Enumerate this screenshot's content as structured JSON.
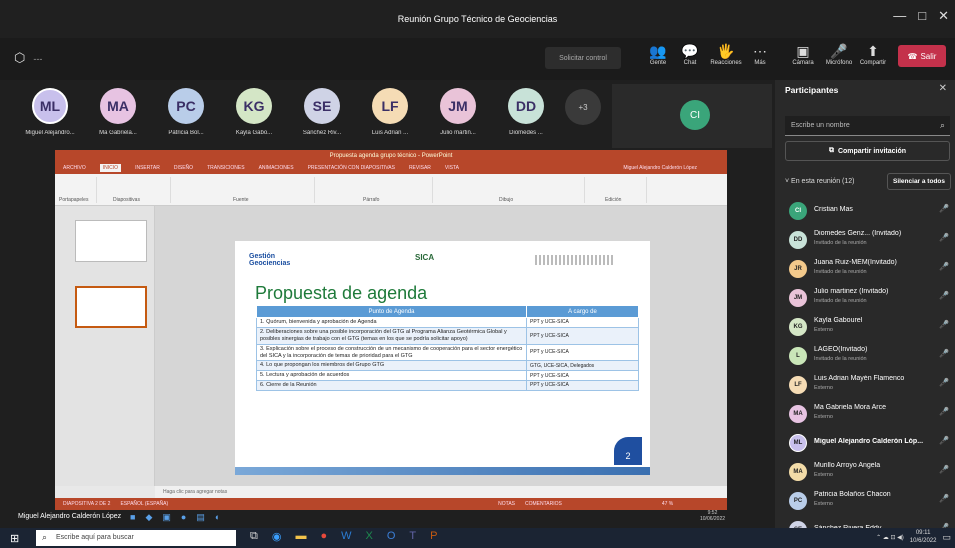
{
  "window": {
    "title": "Reunión Grupo Técnico de Geociencias",
    "minimize": "—",
    "maximize": "□",
    "close": "✕"
  },
  "toolbar": {
    "timer": "---",
    "share_label": "Solicitar control",
    "buttons": [
      {
        "label": "Gente",
        "icon": "people-icon",
        "glyph": "👥"
      },
      {
        "label": "Chat",
        "icon": "chat-icon",
        "glyph": "💬"
      },
      {
        "label": "Reacciones",
        "icon": "reaction-icon",
        "glyph": "🖐"
      },
      {
        "label": "Más",
        "icon": "more-icon",
        "glyph": "⋯"
      },
      {
        "label": "Cámara",
        "icon": "camera-icon",
        "glyph": "▣"
      },
      {
        "label": "Micrófono",
        "icon": "mic-icon",
        "glyph": "🎤"
      },
      {
        "label": "Compartir",
        "icon": "share-icon",
        "glyph": "⬆"
      }
    ],
    "leave": "Salir"
  },
  "gallery": {
    "people": [
      {
        "initials": "ML",
        "name": "Miguel Alejandro...",
        "color": "#c8c0ec"
      },
      {
        "initials": "MA",
        "name": "Ma Gabriela...",
        "color": "#e7c3e2"
      },
      {
        "initials": "PC",
        "name": "Patricia Bol...",
        "color": "#b9cde9"
      },
      {
        "initials": "KG",
        "name": "Kayla Gabo...",
        "color": "#d4e6c6"
      },
      {
        "initials": "SE",
        "name": "Sánchez Riv...",
        "color": "#cfd3e6"
      },
      {
        "initials": "LF",
        "name": "Luis Adrian ...",
        "color": "#f5dcb5"
      },
      {
        "initials": "JM",
        "name": "Julio martin...",
        "color": "#e9c3d8"
      },
      {
        "initials": "DD",
        "name": "Diomedes ...",
        "color": "#c8e2d8"
      }
    ],
    "more": "+3",
    "ci_initials": "CI"
  },
  "ppt": {
    "title": "Propuesta agenda grupo técnico - PowerPoint",
    "tabs": [
      "ARCHIVO",
      "INICIO",
      "INSERTAR",
      "DISEÑO",
      "TRANSICIONES",
      "ANIMACIONES",
      "PRESENTACIÓN CON DIAPOSITIVAS",
      "REVISAR",
      "VISTA"
    ],
    "user": "Miguel Alejandro Calderón López",
    "ribbon_groups": [
      "Portapapeles",
      "Diapositivas",
      "Fuente",
      "Párrafo",
      "Dibujo",
      "Edición"
    ],
    "notes": "Haga clic para agregar notas",
    "status": [
      "DIAPOSITIVA 2 DE 2",
      "ESPAÑOL (ESPAÑA)",
      "NOTAS",
      "COMENTARIOS",
      "47 %"
    ]
  },
  "slide": {
    "logo_left": "Gestión Geociencias",
    "logo_mid": "SICA",
    "title": "Propuesta de agenda",
    "headers": [
      "Punto de Agenda",
      "A cargo de"
    ],
    "rows": [
      [
        "1. Quórum, bienvenida y aprobación de Agenda",
        "PPT y UCE-SICA"
      ],
      [
        "2. Deliberaciones sobre una posible incorporación del GTG al Programa Alianza Geotérmica Global y posibles sinergias de trabajo con el GTG (temas en los que se podría solicitar apoyo)",
        "PPT y UCE-SICA"
      ],
      [
        "3. Explicación sobre el proceso de construcción de un mecanismo de cooperación para el sector energético del SICA y la incorporación de temas de prioridad para el GTG",
        "PPT y UCE-SICA"
      ],
      [
        "4. Lo que propongan los miembros del Grupo GTG",
        "GTG, UCE-SICA, Delegados"
      ],
      [
        "5. Lectura y aprobación de acuerdos",
        "PPT y UCE-SICA"
      ],
      [
        "6. Cierre de la Reunión",
        "PPT y UCE-SICA"
      ]
    ],
    "number": "2"
  },
  "sharer": {
    "name": "Miguel Alejandro Calderón López",
    "time": "9:52",
    "date": "10/06/2022"
  },
  "panel": {
    "title": "Participantes",
    "search_placeholder": "Escribe un nombre",
    "invite": "Compartir invitación",
    "in_meeting": "En esta reunión (12)",
    "mute_all": "Silenciar a todos",
    "participants": [
      {
        "initials": "CI",
        "name": "Cristian Mas",
        "role": "",
        "color": "#3aa57a"
      },
      {
        "initials": "DD",
        "name": "Diomedes Genz... (Invitado)",
        "role": "Invitado de la reunión",
        "color": "#c8e2d8"
      },
      {
        "initials": "JR",
        "name": "Juana Ruiz-MEM(Invitado)",
        "role": "Invitado de la reunión",
        "color": "#f3c98b"
      },
      {
        "initials": "JM",
        "name": "Julio martinez (Invitado)",
        "role": "Invitado de la reunión",
        "color": "#e9c3d8"
      },
      {
        "initials": "KG",
        "name": "Kayla Gabourel",
        "role": "Externo",
        "color": "#d4e6c6"
      },
      {
        "initials": "L",
        "name": "LAGEO(Invitado)",
        "role": "Invitado de la reunión",
        "color": "#c9e6b8"
      },
      {
        "initials": "LF",
        "name": "Luis Adrian Mayén Flamenco",
        "role": "Externo",
        "color": "#f5dcb5"
      },
      {
        "initials": "MA",
        "name": "Ma Gabriela Mora Arce",
        "role": "Externo",
        "color": "#e7c3e2"
      },
      {
        "initials": "ML",
        "name": "Miguel Alejandro Calderón Lóp...",
        "role": "",
        "color": "#c8c0ec"
      },
      {
        "initials": "MA",
        "name": "Murillo Arroyo Angela",
        "role": "Externo",
        "color": "#f3dca8"
      },
      {
        "initials": "PC",
        "name": "Patricia Bolaños Chacon",
        "role": "Externo",
        "color": "#b9cde9"
      },
      {
        "initials": "SE",
        "name": "Sánchez Rivera Eddy",
        "role": "",
        "color": "#cfd3e6"
      }
    ]
  },
  "taskbar": {
    "search": "Escribe aquí para buscar",
    "time": "09:11",
    "date": "10/6/2022"
  }
}
